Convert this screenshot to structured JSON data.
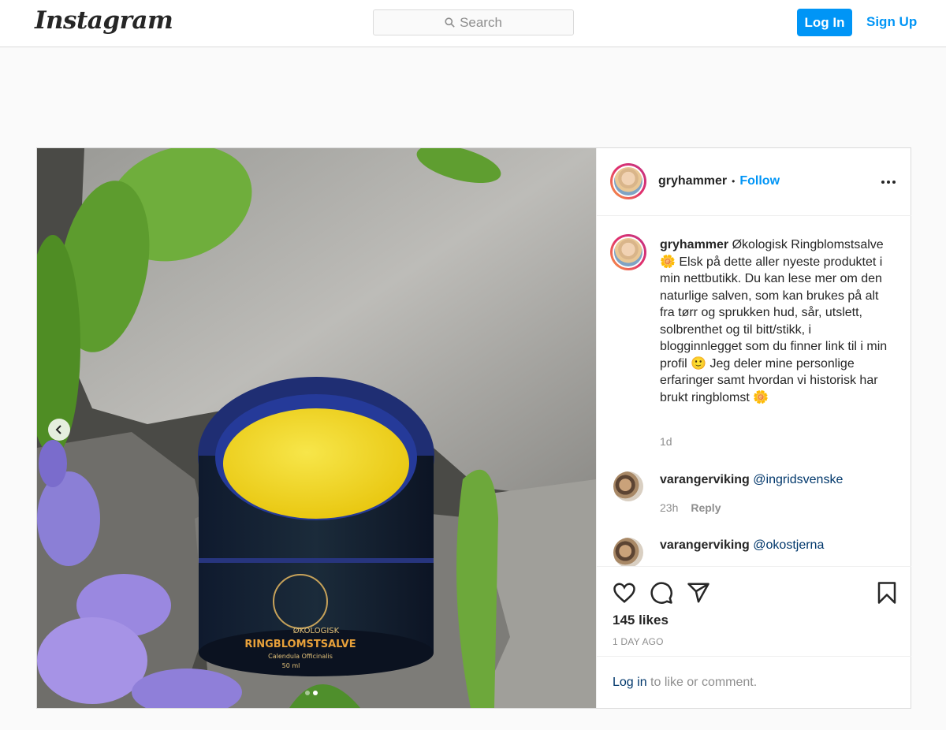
{
  "topbar": {
    "logo": "Instagram",
    "search_placeholder": "Search",
    "login_label": "Log In",
    "signup_label": "Sign Up"
  },
  "post": {
    "author": "gryhammer",
    "separator": "•",
    "follow_label": "Follow",
    "image_product_text": {
      "line1": "ØKOLOGISK",
      "line2": "RINGBLOMSTSALVE",
      "line3": "Calendula Officinalis",
      "line4": "50 ml"
    },
    "caption": {
      "username": "gryhammer",
      "text": "Økologisk Ringblomstsalve 🌼 Elsk på dette aller nyeste produktet i min nettbutikk. Du kan lese mer om den naturlige salven, som kan brukes på alt fra tørr og sprukken hud, sår, utslett, solbrenthet og til bitt/stikk, i blogginnlegget som du finner link til i min profil 🙂 Jeg deler mine personlige erfaringer samt hvordan vi historisk har brukt ringblomst 🌼",
      "time": "1d"
    },
    "comments": [
      {
        "username": "varangerviking",
        "mention": "@ingridsvenske",
        "time": "23h",
        "reply_label": "Reply"
      },
      {
        "username": "varangerviking",
        "mention": "@okostjerna"
      }
    ],
    "likes": "145 likes",
    "time_ago": "1 DAY AGO",
    "login_prompt": {
      "link": "Log in",
      "rest": " to like or comment."
    }
  }
}
